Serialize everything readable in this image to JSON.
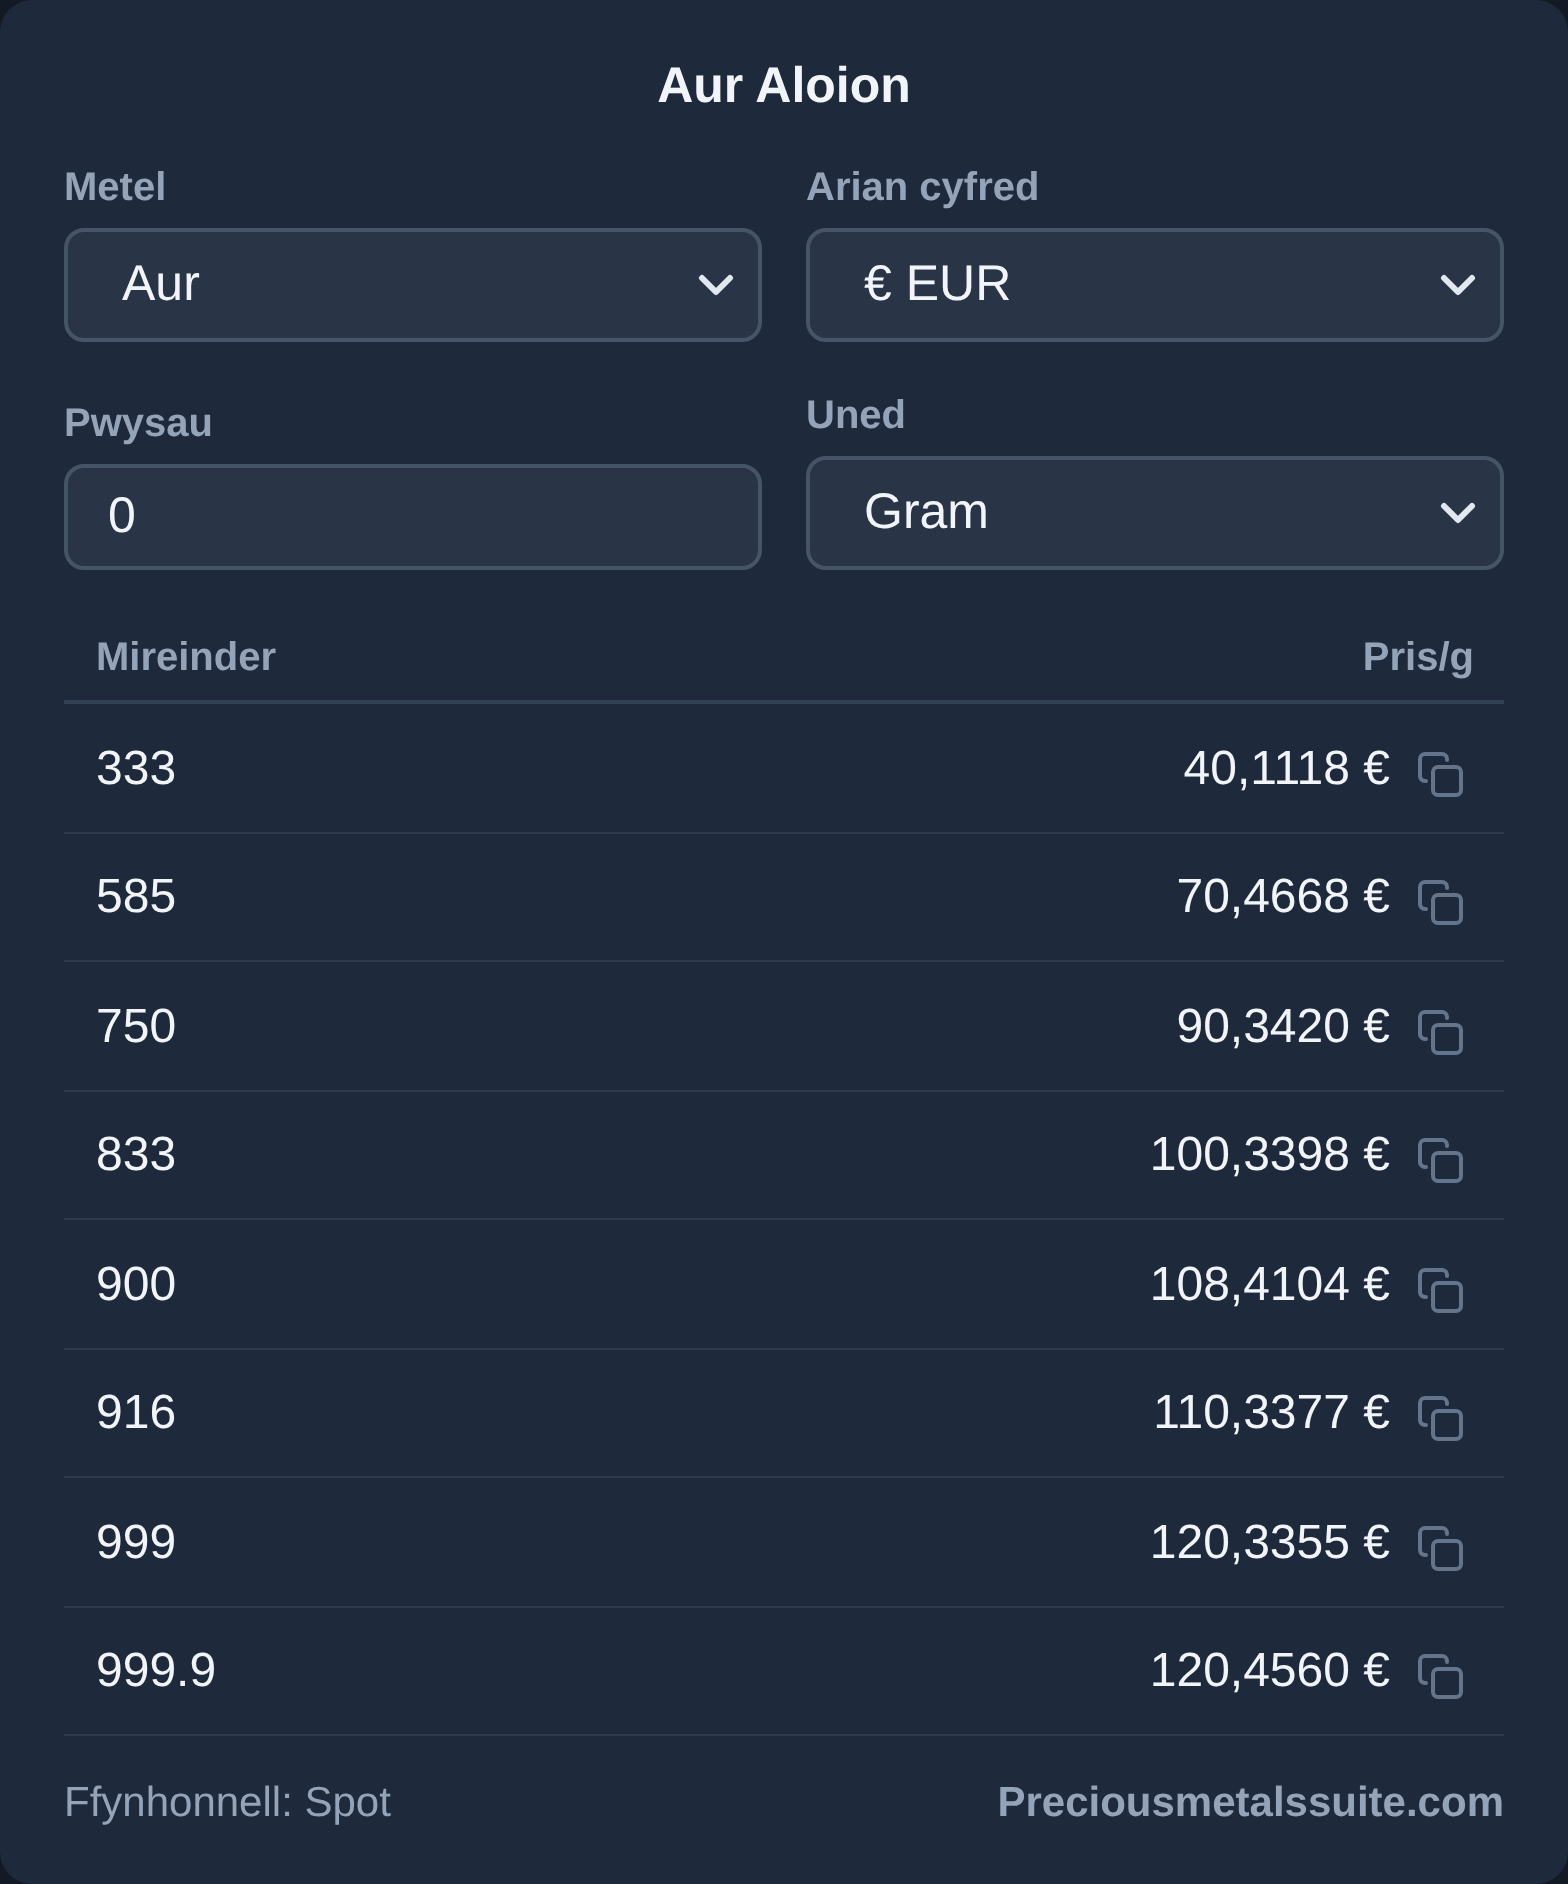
{
  "title": "Aur Aloion",
  "fields": [
    {
      "kind": "select",
      "label": "Metel",
      "value": "Aur"
    },
    {
      "kind": "select",
      "label": "Arian cyfred",
      "value": "€ EUR"
    },
    {
      "kind": "input",
      "label": "Pwysau",
      "value": "0"
    },
    {
      "kind": "select",
      "label": "Uned",
      "value": "Gram"
    }
  ],
  "table": {
    "columns": [
      "Mireinder",
      "Pris/g"
    ],
    "rows": [
      {
        "purity": "333",
        "price": "40,1118 €"
      },
      {
        "purity": "585",
        "price": "70,4668 €"
      },
      {
        "purity": "750",
        "price": "90,3420 €"
      },
      {
        "purity": "833",
        "price": "100,3398 €"
      },
      {
        "purity": "900",
        "price": "108,4104 €"
      },
      {
        "purity": "916",
        "price": "110,3377 €"
      },
      {
        "purity": "999",
        "price": "120,3355 €"
      },
      {
        "purity": "999.9",
        "price": "120,4560 €"
      }
    ]
  },
  "footer": {
    "source": "Ffynhonnell: Spot",
    "link": "Preciousmetalssuite.com"
  }
}
